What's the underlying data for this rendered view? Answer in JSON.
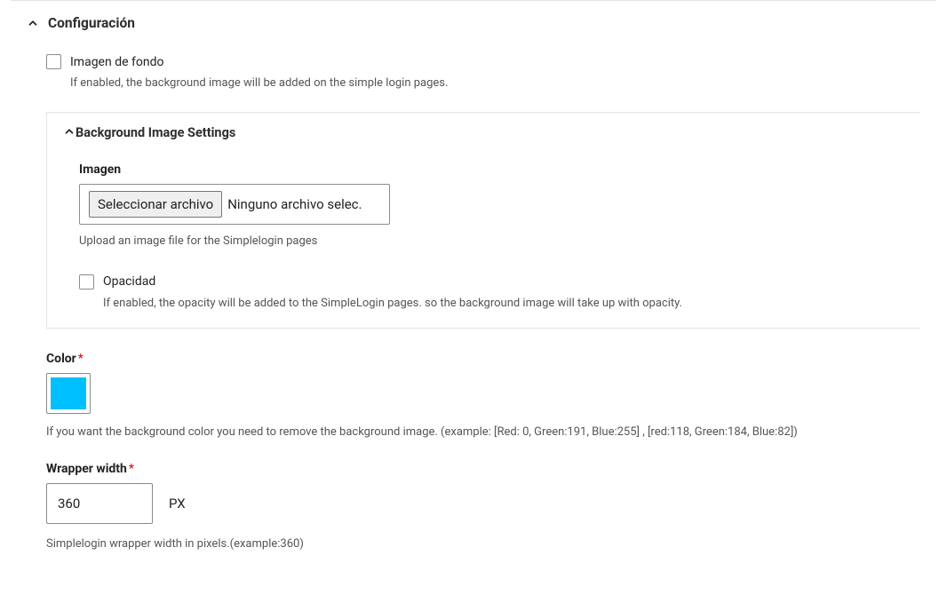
{
  "config": {
    "title": "Configuración",
    "bg_image_checkbox": {
      "label": "Imagen de fondo",
      "helper": "If enabled, the background image will be added on the simple login pages."
    },
    "bg_settings": {
      "title": "Background Image Settings",
      "image": {
        "label": "Imagen",
        "file_button": "Seleccionar archivo",
        "file_status": "Ninguno archivo selec.",
        "helper": "Upload an image file for the Simplelogin pages"
      },
      "opacity": {
        "label": "Opacidad",
        "helper": "If enabled, the opacity will be added to the SimpleLogin pages. so the background image will take up with opacity."
      }
    },
    "color": {
      "label": "Color",
      "value": "#00bfff",
      "helper": "If you want the background color you need to remove the background image. (example: [Red: 0, Green:191, Blue:255] , [red:118, Green:184, Blue:82])"
    },
    "wrapper": {
      "label": "Wrapper width",
      "value": "360",
      "unit": "PX",
      "helper": "Simplelogin wrapper width in pixels.(example:360)"
    }
  }
}
